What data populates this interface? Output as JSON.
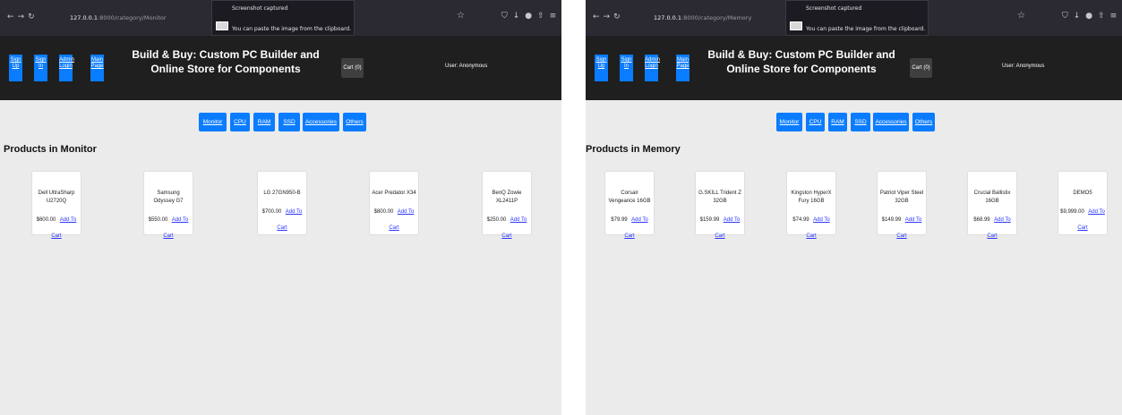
{
  "panes": [
    {
      "url_host": "127.0.0.1",
      "url_path": ":8000/category/Monitor",
      "toast": {
        "title": "Screenshot captured",
        "body": "You can paste the image from the clipboard."
      },
      "header": {
        "buttons": [
          "Sign Up",
          "Sign In",
          "Admin Login",
          "Main Page"
        ],
        "title": "Build & Buy: Custom PC Builder and Online Store for Components",
        "cart": "Cart (0)",
        "user": "User: Anonymous"
      },
      "categories": [
        "Monitor",
        "CPU",
        "RAM",
        "SSD",
        "Accessories",
        "Others"
      ],
      "section_title": "Products in Monitor",
      "products": [
        {
          "name": "Dell UltraSharp U2720Q",
          "price": "$600.00",
          "action": "Add To Cart"
        },
        {
          "name": "Samsung Odyssey G7",
          "price": "$550.00",
          "action": "Add To Cart"
        },
        {
          "name": "LG 27GN950-B",
          "price": "$700.00",
          "action": "Add To Cart"
        },
        {
          "name": "Acer Predator X34",
          "price": "$800.00",
          "action": "Add To Cart"
        },
        {
          "name": "BenQ Zowie XL2411P",
          "price": "$250.00",
          "action": "Add To Cart"
        }
      ]
    },
    {
      "url_host": "127.0.0.1",
      "url_path": ":8000/category/Memory",
      "toast": {
        "title": "Screenshot captured",
        "body": "You can paste the image from the clipboard."
      },
      "header": {
        "buttons": [
          "Sign Up",
          "Sign In",
          "Admin Login",
          "Main Page"
        ],
        "title": "Build & Buy: Custom PC Builder and Online Store for Components",
        "cart": "Cart (0)",
        "user": "User: Anonymous"
      },
      "categories": [
        "Monitor",
        "CPU",
        "RAM",
        "SSD",
        "Accessories",
        "Others"
      ],
      "section_title": "Products in Memory",
      "products": [
        {
          "name": "Corsair Vengeance 16GB",
          "price": "$79.99",
          "action": "Add To Cart"
        },
        {
          "name": "G.SKILL Trident Z 32GB",
          "price": "$159.99",
          "action": "Add To Cart"
        },
        {
          "name": "Kingston HyperX Fury 16GB",
          "price": "$74.99",
          "action": "Add To Cart"
        },
        {
          "name": "Patriot Viper Steel 32GB",
          "price": "$149.99",
          "action": "Add To Cart"
        },
        {
          "name": "Crucial Ballistix 16GB",
          "price": "$68.99",
          "action": "Add To Cart"
        },
        {
          "name": "DEMO5",
          "price": "$9,999.00",
          "action": "Add To Cart"
        }
      ]
    }
  ]
}
